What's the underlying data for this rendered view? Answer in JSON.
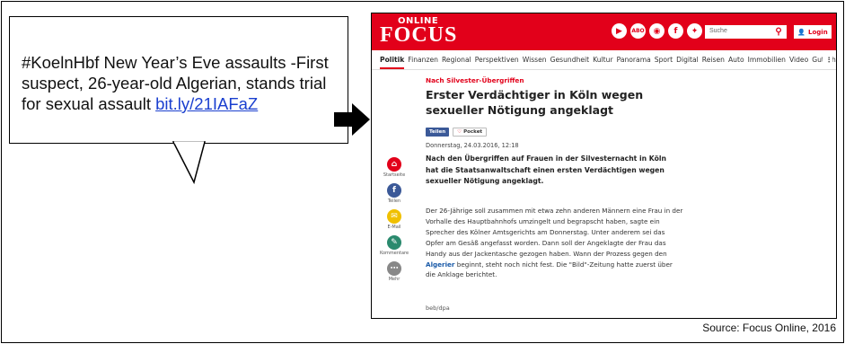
{
  "tweet": {
    "text": "#KoelnHbf New Year’s Eve assaults -First suspect, 26-year-old Algerian, stands trial for sexual assault ",
    "link": "bit.ly/21IAFaZ"
  },
  "site": {
    "logo_top": "ONLINE",
    "logo_main": "FOCUS",
    "social_icons": [
      "youtube-icon",
      "abo-icon",
      "instagram-icon",
      "facebook-icon",
      "twitter-icon"
    ],
    "abo_label": "ABO",
    "search_placeholder": "Suche",
    "login_label": "Login",
    "nav": [
      "Politik",
      "Finanzen",
      "Regional",
      "Perspektiven",
      "Wissen",
      "Gesundheit",
      "Kultur",
      "Panorama",
      "Sport",
      "Digital",
      "Reisen",
      "Auto",
      "Immobilien",
      "Video",
      "Gutscheine"
    ],
    "nav_more": "⋮",
    "brand_color": "#e2001a"
  },
  "article": {
    "kicker": "Nach Silvester-Übergriffen",
    "headline": "Erster Verdächtiger in Köln wegen sexueller Nötigung angeklagt",
    "share_teilen": "Teilen",
    "share_pocket": "Pocket",
    "date": "Donnerstag, 24.03.2016, 12:18",
    "lead": "Nach den Übergriffen auf Frauen in der Silvesternacht in Köln hat die Staatsanwaltschaft einen ersten Verdächtigen wegen sexueller Nötigung angeklagt.",
    "body_before_link": "Der 26-Jährige soll zusammen mit etwa zehn anderen Männern eine Frau in der Vorhalle des Hauptbahnhofs umzingelt und begrapscht haben, sagte ein Sprecher des Kölner Amtsgerichts am Donnerstag. Unter anderem sei das Opfer am Gesäß angefasst worden. Dann soll der Angeklagte der Frau das Handy aus der Jackentasche gezogen haben. Wann der Prozess gegen den ",
    "body_link": "Algerier",
    "body_after_link": " beginnt, steht noch nicht fest. Die \"Bild\"-Zeitung hatte zuerst über die Anklage berichtet.",
    "credit": "beb/dpa"
  },
  "sidebar": [
    {
      "label": "Startseite",
      "icon": "home-icon",
      "color": "#e2001a"
    },
    {
      "label": "Teilen",
      "icon": "facebook-icon",
      "color": "#3b5998"
    },
    {
      "label": "E-Mail",
      "icon": "mail-icon",
      "color": "#f0c000"
    },
    {
      "label": "Kommentare",
      "icon": "comment-icon",
      "color": "#2a8a6e"
    },
    {
      "label": "Mehr",
      "icon": "more-icon",
      "color": "#888888"
    }
  ],
  "source": "Source: Focus Online, 2016"
}
